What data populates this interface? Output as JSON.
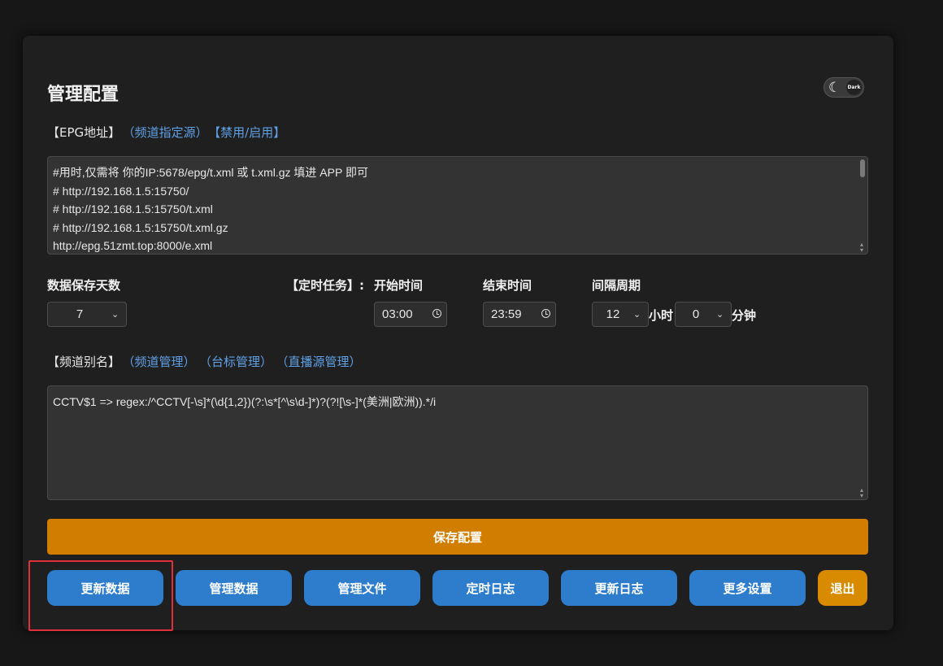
{
  "page": {
    "title": "管理配置",
    "theme_toggle": {
      "label": "Dark",
      "icon": "moon-icon"
    }
  },
  "epg": {
    "label_main": "【EPG地址】",
    "link_channel_source": "（频道指定源）",
    "link_toggle": "【禁用/启用】",
    "lines": [
      "#用时,仅需将 你的IP:5678/epg/t.xml 或 t.xml.gz 填进 APP 即可",
      "# http://192.168.1.5:15750/",
      "# http://192.168.1.5:15750/t.xml",
      "# http://192.168.1.5:15750/t.xml.gz",
      "http://epg.51zmt.top:8000/e.xml"
    ]
  },
  "settings": {
    "retention_label": "数据保存天数",
    "retention_value": "7",
    "cron_label": "【定时任务】:",
    "start_label": "开始时间",
    "start_value": "03:00",
    "end_label": "结束时间",
    "end_value": "23:59",
    "interval_label": "间隔周期",
    "interval_hours": "12",
    "hours_unit": "小时",
    "interval_minutes": "0",
    "minutes_unit": "分钟"
  },
  "alias": {
    "label_main": "【频道别名】",
    "link_channel_manage": "（频道管理）",
    "link_logo_manage": "（台标管理）",
    "link_live_manage": "（直播源管理）",
    "content": "CCTV$1 => regex:/^CCTV[-\\s]*(\\d{1,2})(?:\\s*[^\\s\\d-]*)?(?![\\s-]*(美洲|欧洲)).*/i"
  },
  "actions": {
    "save": "保存配置",
    "buttons": [
      "更新数据",
      "管理数据",
      "管理文件",
      "定时日志",
      "更新日志",
      "更多设置"
    ],
    "logout": "退出"
  },
  "colors": {
    "background": "#171717",
    "card": "#1f1f1f",
    "link": "#5fa0e6",
    "primary_button": "#2e7dcc",
    "save_button": "#d17d00",
    "highlight": "#e0303a"
  }
}
